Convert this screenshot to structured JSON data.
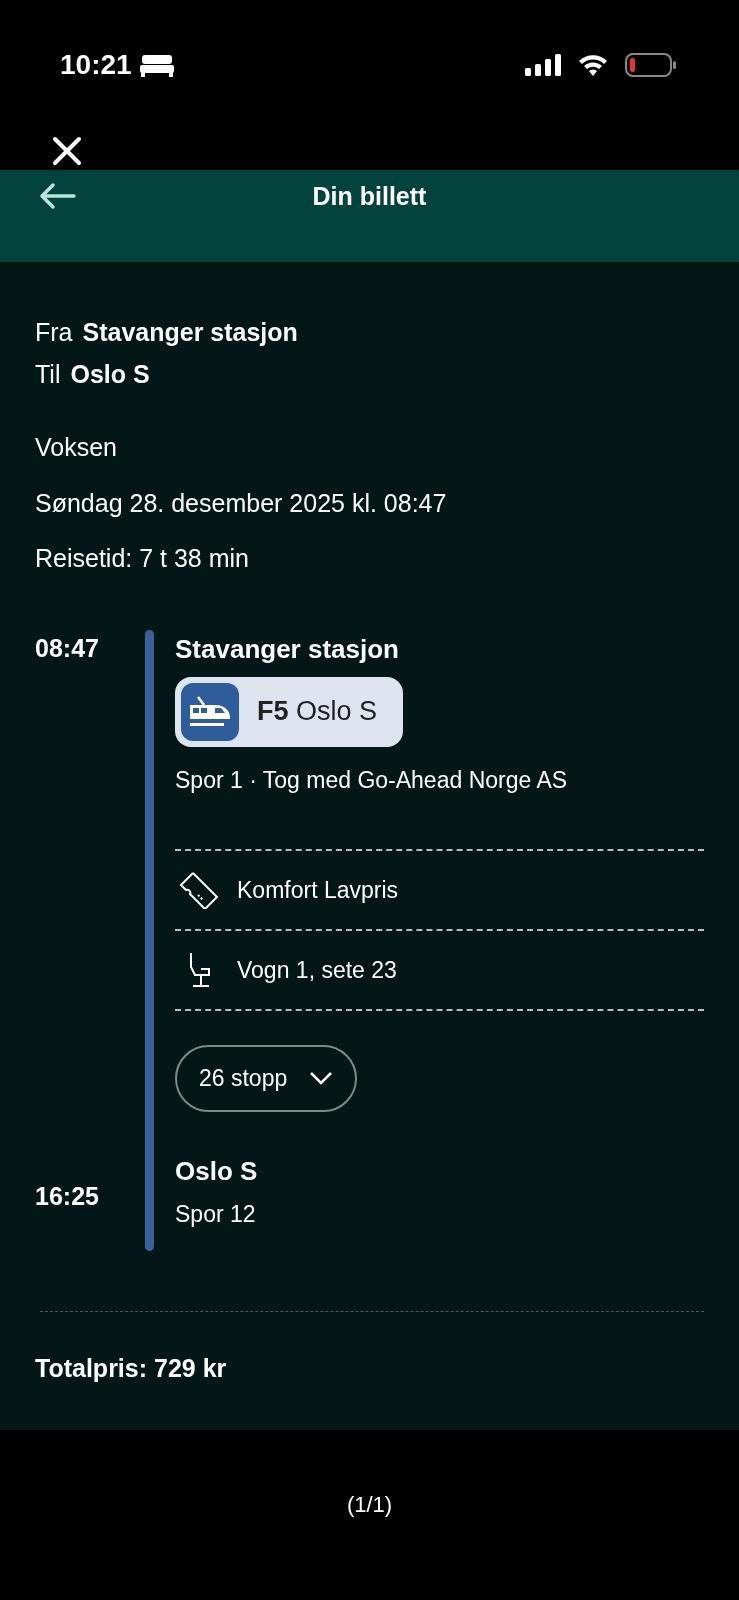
{
  "status_bar": {
    "time": "10:21"
  },
  "header": {
    "title": "Din billett"
  },
  "trip": {
    "from_label": "Fra",
    "from": "Stavanger stasjon",
    "to_label": "Til",
    "to": "Oslo S"
  },
  "passenger": "Voksen",
  "date": "Søndag 28. desember 2025 kl. 08:47",
  "duration": "Reisetid: 7 t 38 min",
  "departure": {
    "time": "08:47",
    "station": "Stavanger stasjon"
  },
  "line": {
    "code": "F5",
    "destination": "Oslo S"
  },
  "info": "Spor 1 · Tog med Go-Ahead Norge AS",
  "details": [
    {
      "kind": "ticket",
      "text": "Komfort Lavpris"
    },
    {
      "kind": "seat",
      "text": "Vogn 1, sete 23"
    }
  ],
  "stops_button": "26 stopp",
  "arrival": {
    "time": "16:25",
    "station": "Oslo S",
    "platform": "Spor 12"
  },
  "total": "Totalpris: 729 kr",
  "page_indicator": "(1/1)"
}
